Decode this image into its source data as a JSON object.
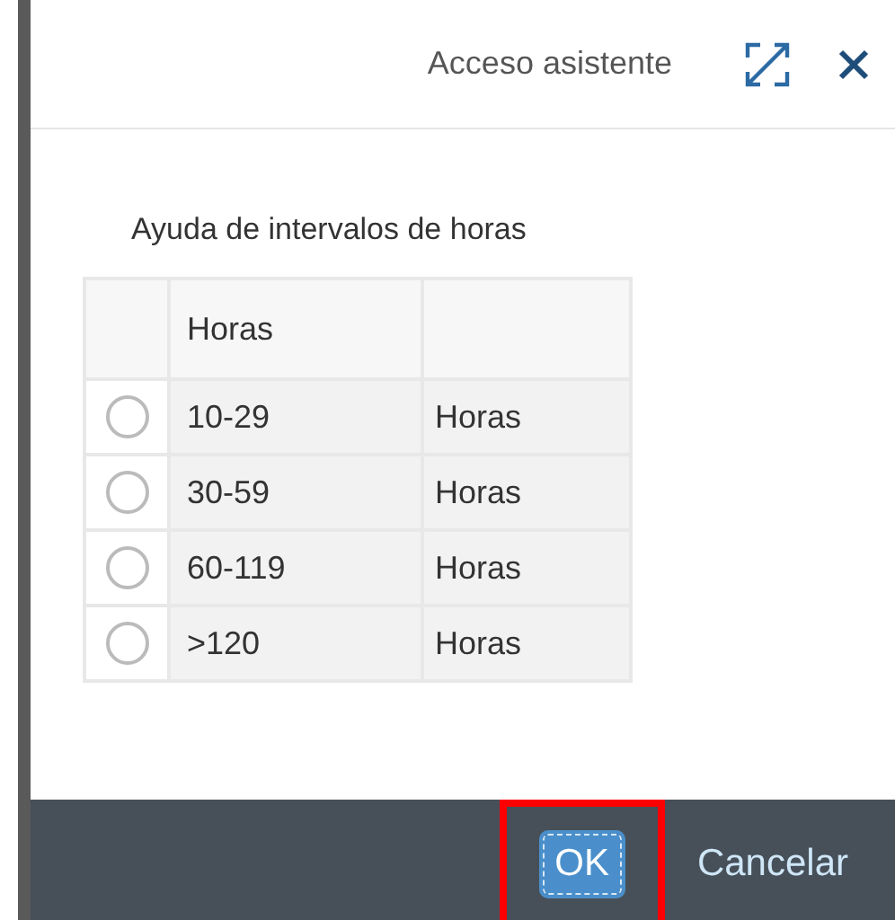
{
  "header": {
    "title": "Acceso asistente"
  },
  "table": {
    "caption": "Ayuda de intervalos de horas",
    "columns": [
      "Horas"
    ],
    "rows": [
      {
        "selected": false,
        "range": "10-29",
        "unit": "Horas"
      },
      {
        "selected": false,
        "range": "30-59",
        "unit": "Horas"
      },
      {
        "selected": false,
        "range": "60-119",
        "unit": "Horas"
      },
      {
        "selected": false,
        "range": ">120",
        "unit": "Horas"
      }
    ]
  },
  "footer": {
    "buttons": [
      {
        "label": "OK",
        "kind": "primary",
        "highlighted": true
      },
      {
        "label": "Cancelar",
        "kind": "plain",
        "highlighted": false
      }
    ]
  }
}
